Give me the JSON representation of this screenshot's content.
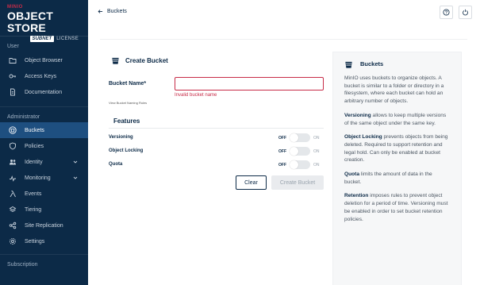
{
  "brand": {
    "top": "MINIO",
    "main": "OBJECT STORE",
    "badge": "SUBNET",
    "license": "LICENSE"
  },
  "sidebar": {
    "section_user": "User",
    "user_items": [
      {
        "label": "Object Browser",
        "icon": "folder-icon"
      },
      {
        "label": "Access Keys",
        "icon": "key-icon"
      },
      {
        "label": "Documentation",
        "icon": "document-icon"
      }
    ],
    "section_admin": "Administrator",
    "admin_items": [
      {
        "label": "Buckets",
        "icon": "bucket-icon",
        "active": true
      },
      {
        "label": "Policies",
        "icon": "shield-icon"
      },
      {
        "label": "Identity",
        "icon": "people-icon",
        "expandable": true
      },
      {
        "label": "Monitoring",
        "icon": "monitoring-icon",
        "expandable": true
      },
      {
        "label": "Events",
        "icon": "lambda-icon"
      },
      {
        "label": "Tiering",
        "icon": "tiers-icon"
      },
      {
        "label": "Site Replication",
        "icon": "replication-icon"
      },
      {
        "label": "Settings",
        "icon": "gear-icon"
      }
    ],
    "section_subscription": "Subscription"
  },
  "topbar": {
    "back_label": "Buckets"
  },
  "form": {
    "title": "Create Bucket",
    "bucket_name_label": "Bucket Name*",
    "bucket_name_value": "",
    "bucket_name_error": "Invalid bucket name",
    "bucket_name_note": "View Bucket Naming Rules",
    "features_title": "Features",
    "features": [
      {
        "label": "Versioning",
        "off": "OFF",
        "on": "ON",
        "enabled": false
      },
      {
        "label": "Object Locking",
        "off": "OFF",
        "on": "ON",
        "enabled": false
      },
      {
        "label": "Quota",
        "off": "OFF",
        "on": "ON",
        "enabled": false
      }
    ],
    "clear_label": "Clear",
    "create_label": "Create Bucket"
  },
  "help": {
    "title": "Buckets",
    "intro": "MinIO uses buckets to organize objects. A bucket is similar to a folder or directory in a filesystem, where each bucket can hold an arbitrary number of objects.",
    "versioning_term": "Versioning",
    "versioning_text": " allows to keep multiple versions of the same object under the same key.",
    "locking_term": "Object Locking",
    "locking_text": " prevents objects from being deleted. Required to support retention and legal hold. Can only be enabled at bucket creation.",
    "quota_term": "Quota",
    "quota_text": " limits the amount of data in the bucket.",
    "retention_term": "Retention",
    "retention_text": " imposes rules to prevent object deletion for a period of time. Versioning must be enabled in order to set bucket retention policies."
  },
  "colors": {
    "sidebar_bg": "#0c2a47",
    "active_bg": "#1e4f80",
    "error": "#c72c48",
    "brand_red": "#c72c48"
  }
}
